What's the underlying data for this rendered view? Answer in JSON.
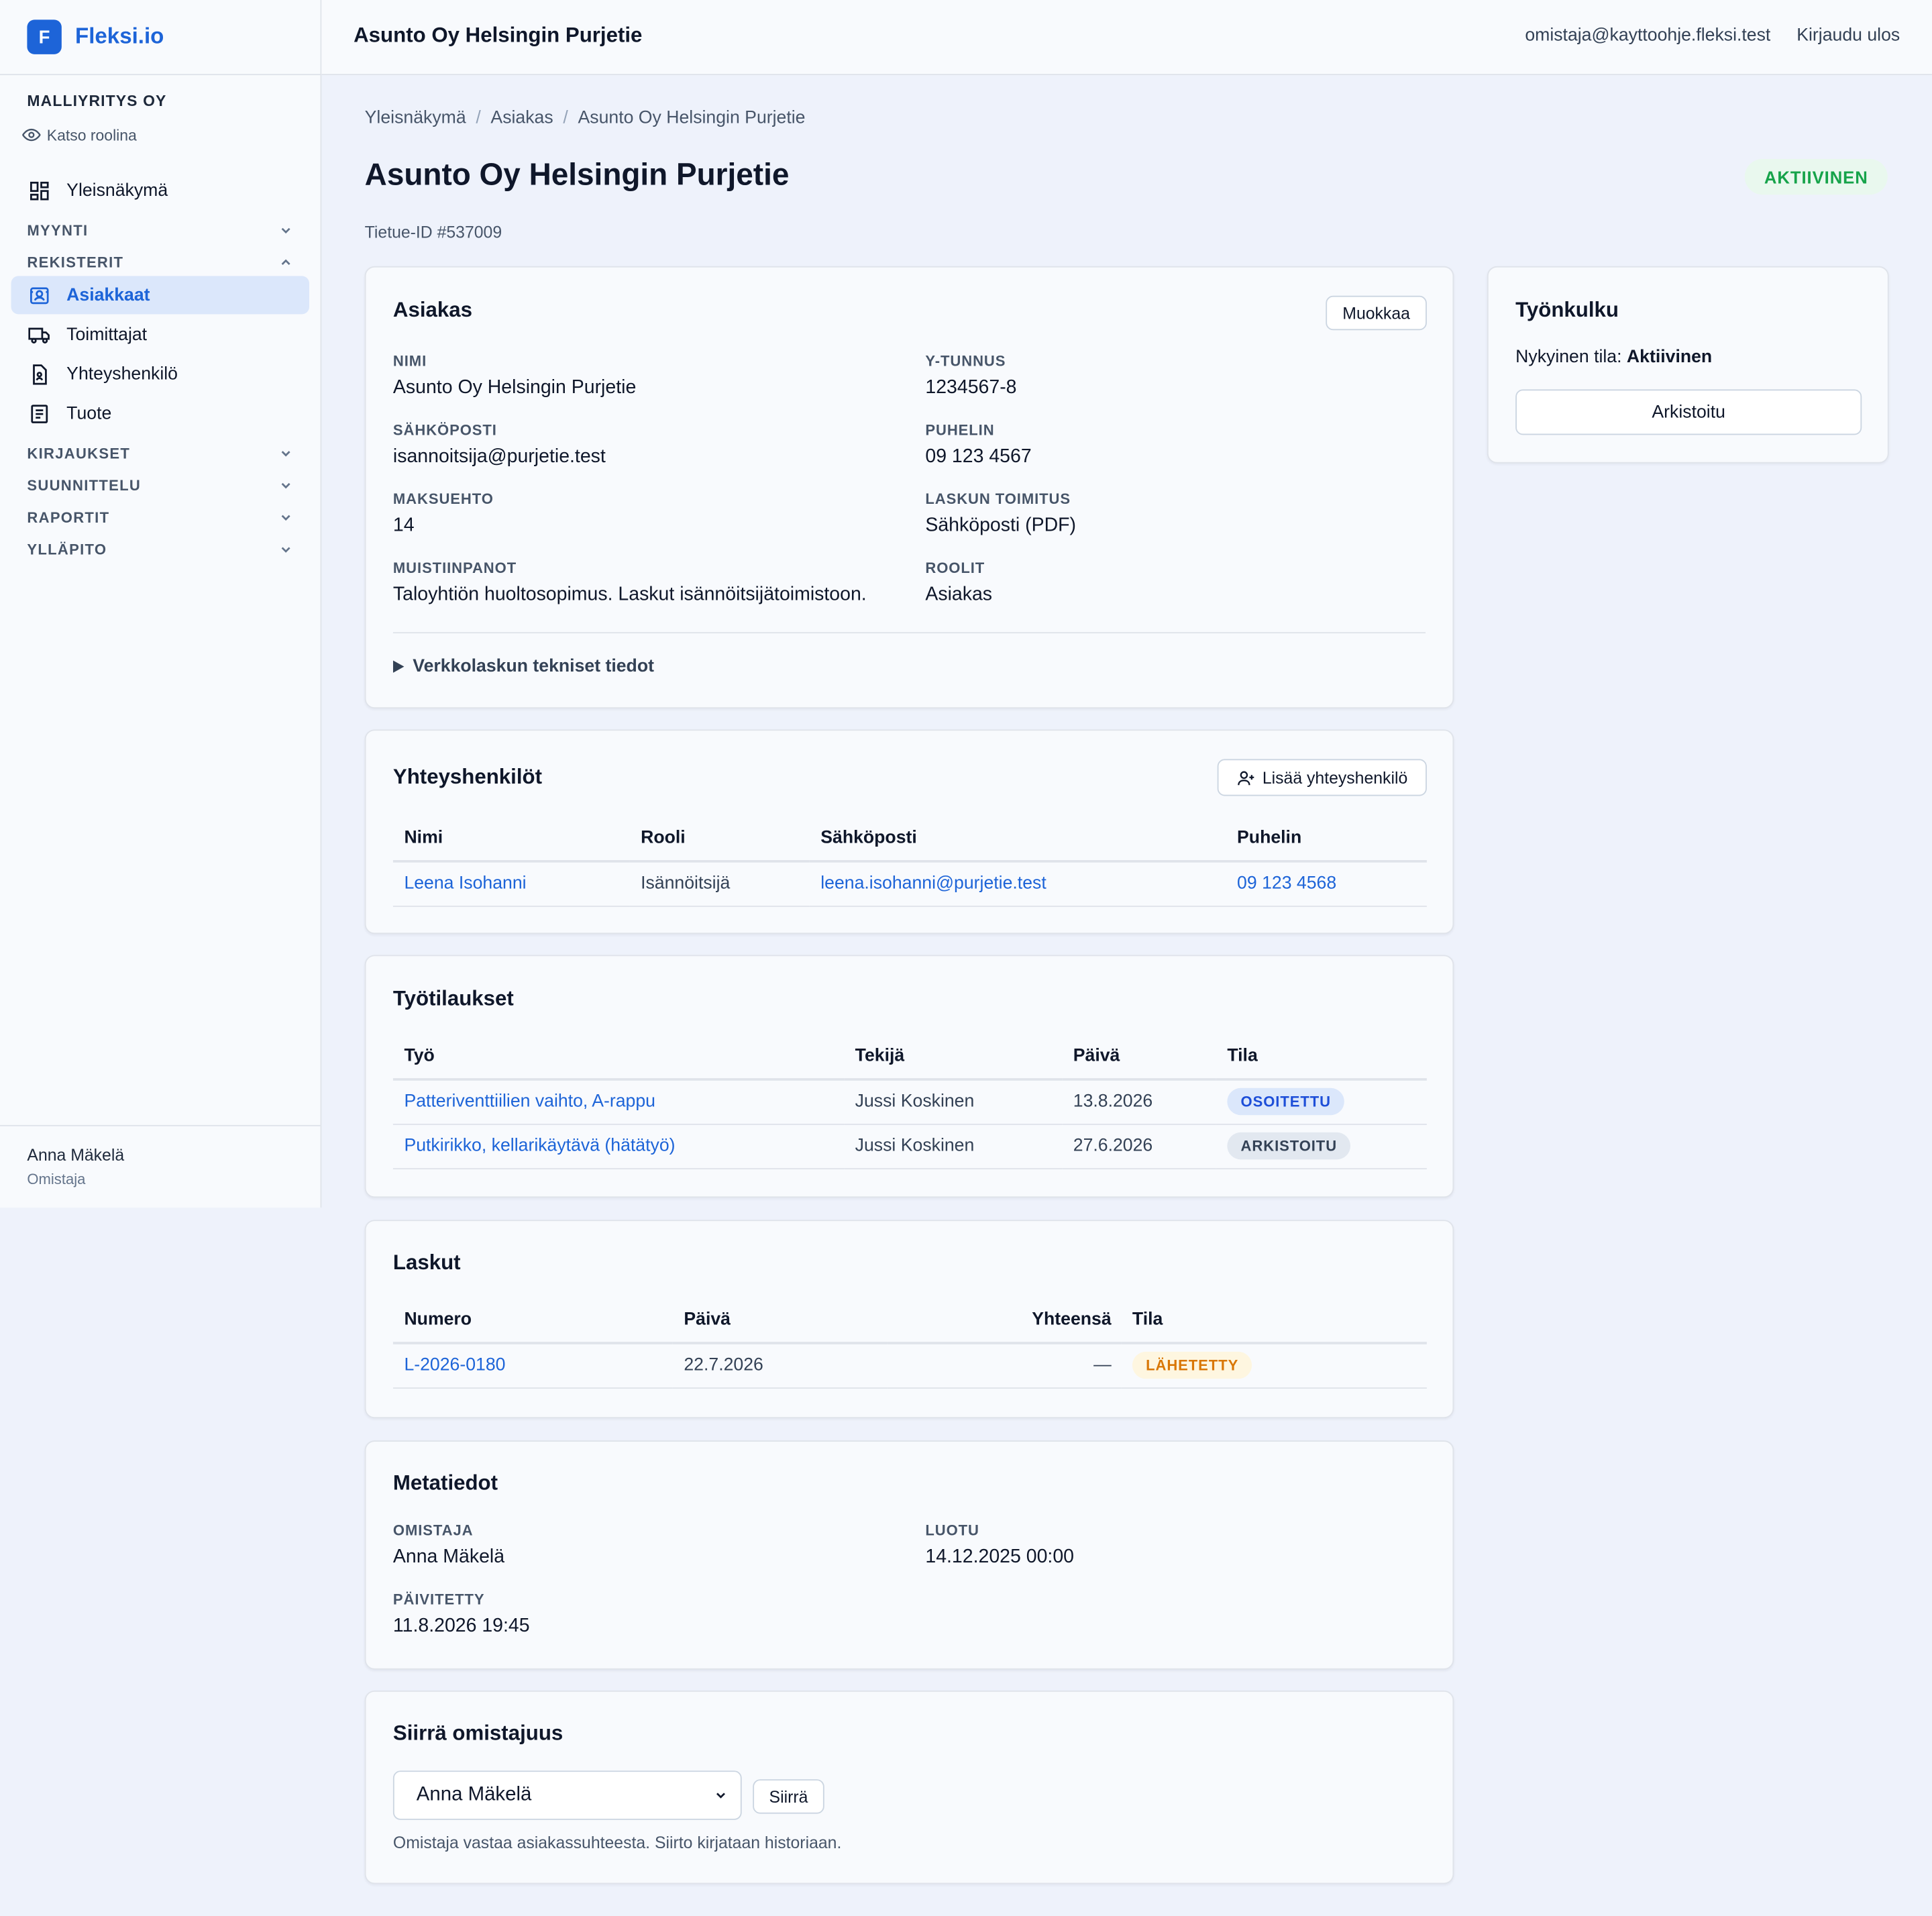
{
  "brand": {
    "logo_letter": "F",
    "name": "Fleksi.io",
    "accent": "#1d64d8"
  },
  "sidebar": {
    "company": "MALLIYRITYS OY",
    "view_role": "Katso roolina",
    "overview": "Yleisnäkymä",
    "sections": {
      "myynti": "MYYNTI",
      "rekisterit": "REKISTERIT",
      "kirjaukset": "KIRJAUKSET",
      "suunnittelu": "SUUNNITTELU",
      "raportit": "RAPORTIT",
      "yllapito": "YLLÄPITO"
    },
    "items": [
      {
        "label": "Asiakkaat",
        "icon": "customer-card-icon",
        "active": true
      },
      {
        "label": "Toimittajat",
        "icon": "truck-icon",
        "active": false
      },
      {
        "label": "Yhteyshenkilö",
        "icon": "contact-file-icon",
        "active": false
      },
      {
        "label": "Tuote",
        "icon": "product-list-icon",
        "active": false
      }
    ],
    "user": {
      "name": "Anna Mäkelä",
      "role": "Omistaja"
    }
  },
  "topbar": {
    "title": "Asunto Oy Helsingin Purjetie",
    "email": "omistaja@kayttoohje.fleksi.test",
    "logout": "Kirjaudu ulos"
  },
  "header": {
    "breadcrumb": [
      "Yleisnäkymä",
      "Asiakas",
      "Asunto Oy Helsingin Purjetie"
    ],
    "title": "Asunto Oy Helsingin Purjetie",
    "status": "AKTIIVINEN",
    "record_id": "Tietue-ID #537009"
  },
  "customer": {
    "title": "Asiakas",
    "edit": "Muokkaa",
    "fields": [
      {
        "label": "NIMI",
        "value": "Asunto Oy Helsingin Purjetie"
      },
      {
        "label": "Y-TUNNUS",
        "value": "1234567-8"
      },
      {
        "label": "SÄHKÖPOSTI",
        "value": "isannoitsija@purjetie.test"
      },
      {
        "label": "PUHELIN",
        "value": "09 123 4567"
      },
      {
        "label": "MAKSUEHTO",
        "value": "14"
      },
      {
        "label": "LASKUN TOIMITUS",
        "value": "Sähköposti (PDF)"
      },
      {
        "label": "MUISTIINPANOT",
        "value": "Taloyhtiön huoltosopimus. Laskut isännöitsijätoimistoon."
      },
      {
        "label": "ROOLIT",
        "value": "Asiakas"
      }
    ],
    "details_toggle": "Verkkolaskun tekniset tiedot"
  },
  "contacts": {
    "title": "Yhteyshenkilöt",
    "add": "Lisää yhteyshenkilö",
    "columns": [
      "Nimi",
      "Rooli",
      "Sähköposti",
      "Puhelin"
    ],
    "rows": [
      {
        "name": "Leena Isohanni",
        "role": "Isännöitsijä",
        "email": "leena.isohanni@purjetie.test",
        "phone": "09 123 4568"
      }
    ]
  },
  "work_orders": {
    "title": "Työtilaukset",
    "columns": [
      "Työ",
      "Tekijä",
      "Päivä",
      "Tila"
    ],
    "rows": [
      {
        "work": "Patteriventtiilien vaihto, A-rappu",
        "worker": "Jussi Koskinen",
        "date": "13.8.2026",
        "status": "OSOITETTU"
      },
      {
        "work": "Putkirikko, kellarikäytävä (hätätyö)",
        "worker": "Jussi Koskinen",
        "date": "27.6.2026",
        "status": "ARKISTOITU"
      }
    ]
  },
  "invoices": {
    "title": "Laskut",
    "columns": [
      "Numero",
      "Päivä",
      "Yhteensä",
      "Tila"
    ],
    "rows": [
      {
        "number": "L-2026-0180",
        "date": "22.7.2026",
        "total": "—",
        "status": "LÄHETETTY"
      }
    ]
  },
  "metadata": {
    "title": "Metatiedot",
    "fields": [
      {
        "label": "OMISTAJA",
        "value": "Anna Mäkelä"
      },
      {
        "label": "LUOTU",
        "value": "14.12.2025 00:00"
      },
      {
        "label": "PÄIVITETTY",
        "value": "11.8.2026 19:45"
      }
    ]
  },
  "transfer": {
    "title": "Siirrä omistajuus",
    "selected": "Anna Mäkelä",
    "button": "Siirrä",
    "hint": "Omistaja vastaa asiakassuhteesta. Siirto kirjataan historiaan."
  },
  "workflow": {
    "title": "Työnkulku",
    "state_label": "Nykyinen tila:",
    "state_value": "Aktiivinen",
    "action": "Arkistoitu"
  }
}
